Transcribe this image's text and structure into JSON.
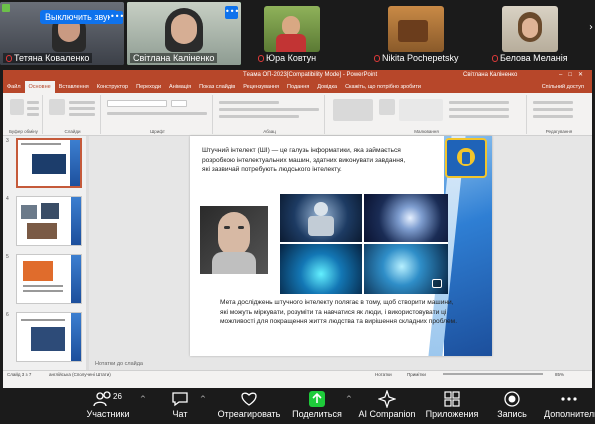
{
  "participants": [
    {
      "name": "Тетяна  Коваленко",
      "muted": true
    },
    {
      "name": "Світлана Каліненко",
      "muted": false,
      "active": true
    },
    {
      "name": "Юра Ковтун",
      "muted": true
    },
    {
      "name": "Nikita Pochepetsky",
      "muted": true
    },
    {
      "name": "Белова Меланія",
      "muted": true
    }
  ],
  "mute_banner": "Выключить звук",
  "ppt": {
    "window_title": "Тeaма ОП-2023[Compatibility Mode] - PowerPoint",
    "user": "Світлана Каліненко",
    "tabs": [
      "Файл",
      "Основне",
      "Вставлення",
      "Конструктор",
      "Переходи",
      "Анімація",
      "Показ слайдів",
      "Рецензування",
      "Подання",
      "Довідка",
      "Скажіть, що потрібно зробити"
    ],
    "share_label": "Спільний доступ",
    "ribbon_groups": [
      "Буфер обміну",
      "Слайди",
      "Шрифт",
      "Абзац",
      "Малювання",
      "Редагування"
    ],
    "slide_text_1": "Штучний інтелект (ШІ) — це галузь інформатики, яка займається розробкою інтелектуальних машин, здатних виконувати завдання, які зазвичай потребують людського інтелекту.",
    "slide_text_2": "Мета досліджень штучного інтелекту полягає в тому, щоб створити машини, які можуть міркувати, розуміти та навчатися як люди, і використовувати ці можливості для покращення життя людства та вирішення складних проблем.",
    "notes_placeholder": "Нотатки до слайда",
    "status_left": "Слайд 3 з 7",
    "status_lang": "англійська (Сполучені Штати)",
    "status_notes": "Нотатки",
    "status_comments": "Примітки",
    "zoom": "85%",
    "thumb_numbers": [
      "3",
      "4",
      "5",
      "6",
      "7"
    ]
  },
  "toolbar": {
    "participants_label": "Участники",
    "participants_count": "26",
    "chat_label": "Чат",
    "react_label": "Отреагировать",
    "share_label": "Поделиться",
    "companion_label": "AI Companion",
    "apps_label": "Приложения",
    "record_label": "Запись",
    "more_label": "Дополнительно"
  },
  "colors": {
    "ppt_accent": "#b7472a",
    "zoom_green": "#1ecb3a",
    "zoom_blue": "#0e72ed",
    "share_green": "#1ecb3a"
  }
}
